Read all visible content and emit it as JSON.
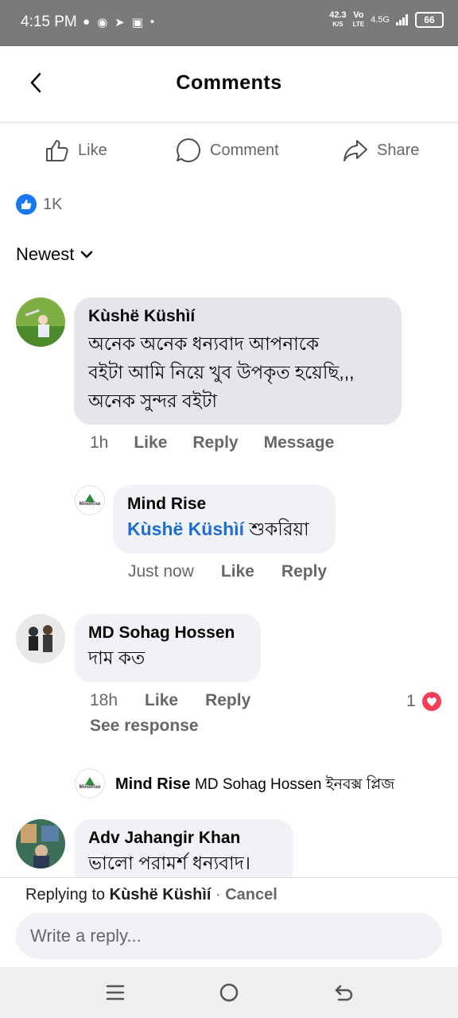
{
  "status_bar": {
    "time": "4:15 PM",
    "speed": "42.3",
    "speed_unit": "K/S",
    "volte_top": "Vo",
    "volte_bottom": "LTE",
    "network": "4.5G",
    "battery": "66"
  },
  "header": {
    "title": "Comments"
  },
  "actions": {
    "like": "Like",
    "comment": "Comment",
    "share": "Share"
  },
  "reactions": {
    "count": "1K"
  },
  "sort": {
    "label": "Newest"
  },
  "comments": [
    {
      "author": "Kùshë Küshìí",
      "lines": [
        "অনেক অনেক ধন্যবাদ আপনাকে",
        "বইটা আমি নিয়ে খুব উপকৃত হয়েছি,,,",
        "অনেক সুন্দর বইটা"
      ],
      "time": "1h",
      "like": "Like",
      "reply": "Reply",
      "message": "Message"
    },
    {
      "author": "Mind Rise",
      "mention": "Kùshë Küshìí",
      "text": "শুকরিয়া",
      "time": "Just now",
      "like": "Like",
      "reply": "Reply",
      "logo_text": "MindRise"
    },
    {
      "author": "MD Sohag Hossen",
      "text": "দাম কত",
      "time": "18h",
      "like": "Like",
      "reply": "Reply",
      "reaction_count": "1",
      "see_response": "See response"
    },
    {
      "author": "Mind Rise",
      "preview": "MD Sohag Hossen ইনবক্স প্লিজ",
      "logo_text": "MindRise"
    },
    {
      "author": "Adv Jahangir Khan",
      "text": "ভালো পরামর্শ  ধন্যবাদ।"
    }
  ],
  "reply_bar": {
    "replying_prefix": "Replying to",
    "replying_name": "Kùshë Küshìí",
    "separator": "·",
    "cancel": "Cancel",
    "placeholder": "Write a reply..."
  },
  "colors": {
    "accent": "#1877f2",
    "mention": "#1f6dd1",
    "heart": "#f33e58",
    "bubble": "#f0f2f5"
  }
}
